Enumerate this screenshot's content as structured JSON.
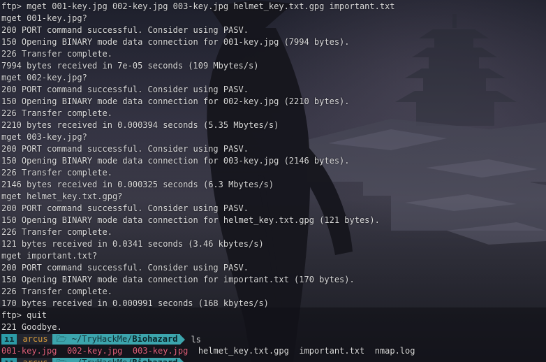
{
  "terminal": {
    "lines": [
      "ftp> mget 001-key.jpg 002-key.jpg 003-key.jpg helmet_key.txt.gpg important.txt",
      "mget 001-key.jpg?",
      "200 PORT command successful. Consider using PASV.",
      "150 Opening BINARY mode data connection for 001-key.jpg (7994 bytes).",
      "226 Transfer complete.",
      "7994 bytes received in 7e-05 seconds (109 Mbytes/s)",
      "mget 002-key.jpg?",
      "200 PORT command successful. Consider using PASV.",
      "150 Opening BINARY mode data connection for 002-key.jpg (2210 bytes).",
      "226 Transfer complete.",
      "2210 bytes received in 0.000394 seconds (5.35 Mbytes/s)",
      "mget 003-key.jpg?",
      "200 PORT command successful. Consider using PASV.",
      "150 Opening BINARY mode data connection for 003-key.jpg (2146 bytes).",
      "226 Transfer complete.",
      "2146 bytes received in 0.000325 seconds (6.3 Mbytes/s)",
      "mget helmet_key.txt.gpg?",
      "200 PORT command successful. Consider using PASV.",
      "150 Opening BINARY mode data connection for helmet_key.txt.gpg (121 bytes).",
      "226 Transfer complete.",
      "121 bytes received in 0.0341 seconds (3.46 kbytes/s)",
      "mget important.txt?",
      "200 PORT command successful. Consider using PASV.",
      "150 Opening BINARY mode data connection for important.txt (170 bytes).",
      "226 Transfer complete.",
      "170 bytes received in 0.000991 seconds (168 kbytes/s)",
      "ftp> quit",
      "221 Goodbye."
    ],
    "prompt": {
      "os_icon": "ıı",
      "user": "arcus",
      "folder_icon": "🗁",
      "path_prefix": "~/TryHackMe/",
      "path_current": "Biohazard",
      "command": "ls"
    },
    "ls_output": [
      {
        "name": "001-key.jpg",
        "color": "#e0607a"
      },
      {
        "name": "002-key.jpg",
        "color": "#e0607a"
      },
      {
        "name": "003-key.jpg",
        "color": "#e0607a"
      },
      {
        "name": "helmet_key.txt.gpg",
        "color": "#d9d9d9"
      },
      {
        "name": "important.txt",
        "color": "#d9d9d9"
      },
      {
        "name": "nmap.log",
        "color": "#d9d9d9"
      }
    ]
  },
  "colors": {
    "prompt_accent": "#3ca5ad",
    "user": "#d79a3b",
    "image_files": "#e0607a",
    "text": "#d9d9d9"
  }
}
